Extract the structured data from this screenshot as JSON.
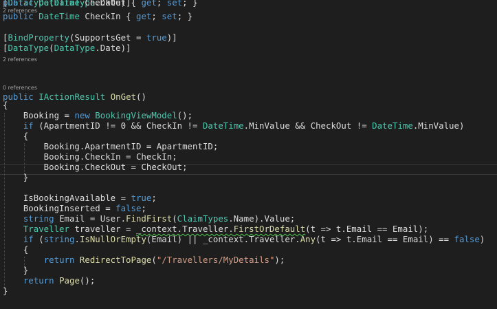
{
  "colors": {
    "background": "#1e1e1e",
    "keyword": "#569cd6",
    "type": "#4ec9b0",
    "method": "#dcdcaa",
    "string": "#d69d85",
    "text": "#dcdcdc",
    "codelens": "#a0a0a0"
  },
  "code_lens": {
    "refs_checkin": "2 references",
    "refs_checkout": "2 references",
    "refs_onget": "0 references"
  },
  "lines": [
    {
      "row": 0,
      "tokens": [
        [
          "[",
          "p"
        ],
        [
          "DataType",
          "ty"
        ],
        [
          "(",
          "p"
        ],
        [
          "DataType",
          "ty"
        ],
        [
          ".Date)]",
          "p"
        ]
      ]
    },
    {
      "row": 2,
      "tokens": [
        [
          "public",
          "kw"
        ],
        [
          " ",
          "p"
        ],
        [
          "DateTime",
          "ty"
        ],
        [
          " CheckIn { ",
          "p"
        ],
        [
          "get",
          "kw"
        ],
        [
          "; ",
          "p"
        ],
        [
          "set",
          "kw"
        ],
        [
          "; }",
          "p"
        ]
      ]
    },
    {
      "row": 4,
      "tokens": [
        [
          "[",
          "p"
        ],
        [
          "BindProperty",
          "ty"
        ],
        [
          "(SupportsGet = ",
          "p"
        ],
        [
          "true",
          "kw"
        ],
        [
          ")]",
          "p"
        ]
      ]
    },
    {
      "row": 5,
      "tokens": [
        [
          "[",
          "p"
        ],
        [
          "DataType",
          "ty"
        ],
        [
          "(",
          "p"
        ],
        [
          "DataType",
          "ty"
        ],
        [
          ".Date)]",
          "p"
        ]
      ]
    },
    {
      "row": 7,
      "tokens": [
        [
          "public",
          "kw"
        ],
        [
          " ",
          "p"
        ],
        [
          "DateTime",
          "ty"
        ],
        [
          " CheckOut { ",
          "p"
        ],
        [
          "get",
          "kw"
        ],
        [
          "; ",
          "p"
        ],
        [
          "set",
          "kw"
        ],
        [
          "; }",
          "p"
        ]
      ]
    },
    {
      "row": 9,
      "tokens": [
        [
          "public",
          "kw"
        ],
        [
          " ",
          "p"
        ],
        [
          "IActionResult",
          "ty"
        ],
        [
          " ",
          "p"
        ],
        [
          "OnGet",
          "me"
        ],
        [
          "()",
          "p"
        ]
      ]
    },
    {
      "row": 10,
      "tokens": [
        [
          "{",
          "p"
        ]
      ]
    },
    {
      "row": 11,
      "tokens": [
        [
          "    Booking = ",
          "p"
        ],
        [
          "new",
          "kw"
        ],
        [
          " ",
          "p"
        ],
        [
          "BookingViewModel",
          "ty"
        ],
        [
          "();",
          "p"
        ]
      ]
    },
    {
      "row": 12,
      "tokens": [
        [
          "    ",
          "p"
        ],
        [
          "if",
          "kw"
        ],
        [
          " (ApartmentID != 0 && CheckIn != ",
          "p"
        ],
        [
          "DateTime",
          "ty"
        ],
        [
          ".MinValue && CheckOut != ",
          "p"
        ],
        [
          "DateTime",
          "ty"
        ],
        [
          ".MinValue)",
          "p"
        ]
      ]
    },
    {
      "row": 13,
      "tokens": [
        [
          "    {",
          "p"
        ]
      ]
    },
    {
      "row": 14,
      "tokens": [
        [
          "        Booking.ApartmentID = ApartmentID;",
          "p"
        ]
      ]
    },
    {
      "row": 15,
      "tokens": [
        [
          "        Booking.CheckIn = CheckIn;",
          "p"
        ]
      ]
    },
    {
      "row": 16,
      "tokens": [
        [
          "        Booking.CheckOut = CheckOut;",
          "p"
        ]
      ]
    },
    {
      "row": 17,
      "tokens": [
        [
          "    }",
          "p"
        ]
      ]
    },
    {
      "row": 19,
      "tokens": [
        [
          "    IsBookingAvailable = ",
          "p"
        ],
        [
          "true",
          "kw"
        ],
        [
          ";",
          "p"
        ]
      ]
    },
    {
      "row": 20,
      "tokens": [
        [
          "    BookingInserted = ",
          "p"
        ],
        [
          "false",
          "kw"
        ],
        [
          ";",
          "p"
        ]
      ]
    },
    {
      "row": 21,
      "tokens": [
        [
          "    ",
          "p"
        ],
        [
          "string",
          "kw"
        ],
        [
          " Email = User.",
          "p"
        ],
        [
          "FindFirst",
          "me"
        ],
        [
          "(",
          "p"
        ],
        [
          "ClaimTypes",
          "ty"
        ],
        [
          ".Name).Value;",
          "p"
        ]
      ]
    },
    {
      "row": 22,
      "tokens": [
        [
          "    ",
          "p"
        ],
        [
          "Traveller",
          "ty"
        ],
        [
          " traveller = ",
          "p"
        ],
        [
          "_context.Traveller.",
          "sq"
        ],
        [
          "FirstOrDefault",
          "mesq"
        ],
        [
          "(t => t.Email == Email);",
          "p"
        ]
      ]
    },
    {
      "row": 23,
      "tokens": [
        [
          "    ",
          "p"
        ],
        [
          "if",
          "kw"
        ],
        [
          " (",
          "p"
        ],
        [
          "string",
          "kw"
        ],
        [
          ".",
          "p"
        ],
        [
          "IsNullOrEmpty",
          "me"
        ],
        [
          "(Email) || _context.Traveller.",
          "p"
        ],
        [
          "Any",
          "me"
        ],
        [
          "(t => t.Email == Email) == ",
          "p"
        ],
        [
          "false",
          "kw"
        ],
        [
          ")",
          "p"
        ]
      ]
    },
    {
      "row": 24,
      "tokens": [
        [
          "    {",
          "p"
        ]
      ]
    },
    {
      "row": 25,
      "tokens": [
        [
          "        ",
          "p"
        ],
        [
          "return",
          "kw"
        ],
        [
          " ",
          "p"
        ],
        [
          "RedirectToPage",
          "me"
        ],
        [
          "(",
          "p"
        ],
        [
          "\"/Travellers/MyDetails\"",
          "st"
        ],
        [
          ");",
          "p"
        ]
      ]
    },
    {
      "row": 26,
      "tokens": [
        [
          "    }",
          "p"
        ]
      ]
    },
    {
      "row": 27,
      "tokens": [
        [
          "    ",
          "p"
        ],
        [
          "return",
          "kw"
        ],
        [
          " ",
          "p"
        ],
        [
          "Page",
          "me"
        ],
        [
          "();",
          "p"
        ]
      ]
    },
    {
      "row": 28,
      "tokens": [
        [
          "}",
          "p"
        ]
      ]
    }
  ]
}
